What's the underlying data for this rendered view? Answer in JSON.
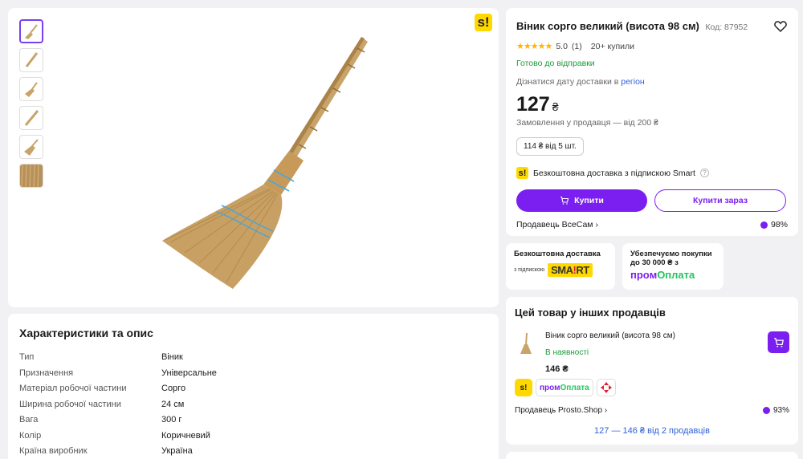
{
  "gallery": {
    "thumb_count": 6,
    "badge": "s!"
  },
  "description": {
    "title": "Характеристики та опис",
    "specs": [
      {
        "k": "Тип",
        "v": "Віник"
      },
      {
        "k": "Призначення",
        "v": "Універсальне"
      },
      {
        "k": "Матеріал робочої частини",
        "v": "Сорго"
      },
      {
        "k": "Ширина робочої частини",
        "v": "24 см"
      },
      {
        "k": "Вага",
        "v": "300 г"
      },
      {
        "k": "Колір",
        "v": "Коричневий"
      },
      {
        "k": "Країна виробник",
        "v": "Україна"
      }
    ]
  },
  "product": {
    "title": "Віник сорго великий (висота 98 см)",
    "code": "Код: 87952",
    "rating": "5.0",
    "reviews": "(1)",
    "bought": "20+ купили",
    "status": "Готово до відправки",
    "delivery_text": "Дізнатися дату доставки в",
    "delivery_link": "регіон",
    "price": "127",
    "currency": "₴",
    "min_order": "Замовлення у продавця — від 200 ₴",
    "wholesale": "114 ₴ від 5 шт.",
    "smart_delivery": "Безкоштовна доставка з підпискою Smart",
    "buy_label": "Купити",
    "buy_now_label": "Купити зараз",
    "seller": "Продавець ВсеСам",
    "seller_rating": "98%"
  },
  "promos": {
    "free_title": "Безкоштовна доставка",
    "free_sub": "з підпискою",
    "smart_logo_a": "SMA",
    "smart_logo_b": "!",
    "smart_logo_c": "RT",
    "safe_title": "Убезпечуємо покупки до 30 000 ₴ з",
    "prom_a": "пром",
    "prom_b": "Оплата"
  },
  "others": {
    "title": "Цей товар у інших продавців",
    "item_name": "Віник сорго великий (висота 98 см)",
    "item_stock": "В наявності",
    "item_price": "146 ₴",
    "chip_prom_a": "пром",
    "chip_prom_b": "Оплата",
    "seller": "Продавець Prosto.Shop",
    "seller_rating": "93%",
    "more": "127 — 146 ₴ від 2 продавців"
  },
  "colors": {
    "accent": "#7a1ff0",
    "green": "#1a9b3a",
    "yellow": "#ffd800"
  }
}
